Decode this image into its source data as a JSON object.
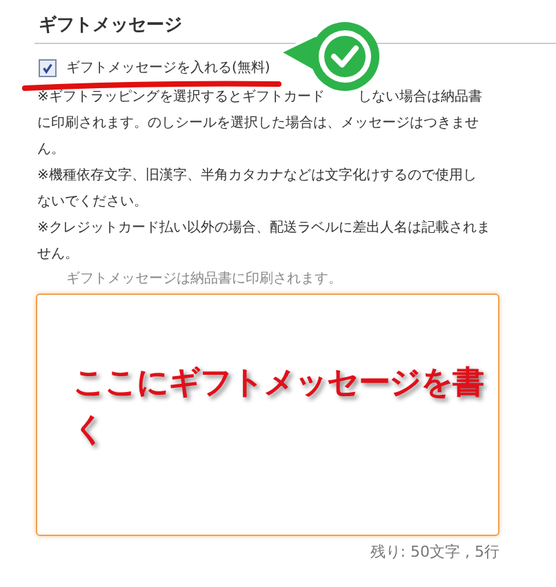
{
  "section_title": "ギフトメッセージ",
  "gift_message_option": {
    "label": "ギフトメッセージを入れる(無料)",
    "checked": true
  },
  "notes": [
    {
      "lines": [
        [
          "※ギフトラッピングを選択するとギフトカード",
          "しない場合は納品書"
        ],
        [
          "に印刷されます。のしシールを選択した場合は、メッセージはつきませ"
        ],
        [
          "ん。"
        ]
      ]
    },
    {
      "lines": [
        [
          "※機種依存文字、旧漢字、半角カタカナなどは文字化けするので使用し"
        ],
        [
          "ないでください。"
        ]
      ]
    },
    {
      "lines": [
        [
          "※クレジットカード払い以外の場合、配送ラベルに差出人名は記載されま"
        ],
        [
          "せん。"
        ]
      ]
    }
  ],
  "message_hint": "ギフトメッセージは納品書に印刷されます。",
  "message_field": {
    "annotation": "ここにギフトメッセージを書く"
  },
  "remaining_counter": "残り: 50文字 , 5行"
}
